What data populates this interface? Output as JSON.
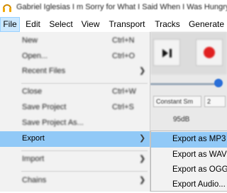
{
  "window": {
    "title": "Gabriel Iglesias I m Sorry for What I Said When I Was Hungry",
    "icon": "headphones-icon"
  },
  "menubar": {
    "items": [
      {
        "label": "File"
      },
      {
        "label": "Edit"
      },
      {
        "label": "Select"
      },
      {
        "label": "View"
      },
      {
        "label": "Transport"
      },
      {
        "label": "Tracks"
      },
      {
        "label": "Generate"
      }
    ]
  },
  "file_menu": {
    "items": [
      {
        "label": "New",
        "shortcut": "Ctrl+N"
      },
      {
        "label": "Open...",
        "shortcut": "Ctrl+O"
      },
      {
        "label": "Recent Files",
        "submenu": true
      },
      {
        "label": "Close",
        "shortcut": "Ctrl+W"
      },
      {
        "label": "Save Project",
        "shortcut": "Ctrl+S"
      },
      {
        "label": "Save Project As..."
      },
      {
        "label": "Export",
        "submenu": true
      },
      {
        "label": "Import",
        "submenu": true
      },
      {
        "label": "Chains",
        "submenu": true
      }
    ]
  },
  "export_submenu": {
    "items": [
      {
        "label": "Export as MP3"
      },
      {
        "label": "Export as WAV"
      },
      {
        "label": "Export as OGG"
      },
      {
        "label": "Export Audio..."
      }
    ]
  },
  "background": {
    "combo_value": "Constant Sm",
    "combo2_value": "2",
    "rate": "95dB",
    "record_color": "#e02020",
    "slider_knob_color": "#2a6fd8"
  },
  "colors": {
    "highlight": "#91c9f7",
    "menu_active": "#cce8ff"
  }
}
